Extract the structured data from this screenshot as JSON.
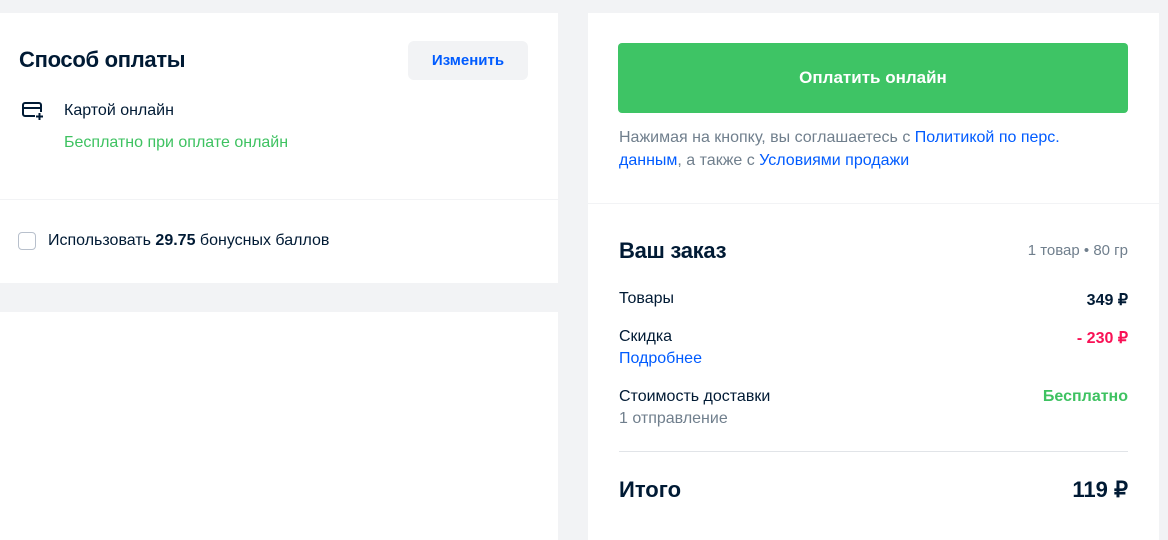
{
  "payment": {
    "title": "Способ оплаты",
    "change_label": "Изменить",
    "method_icon": "card-plus-icon",
    "method_label": "Картой онлайн",
    "method_note": "Бесплатно при оплате онлайн"
  },
  "bonus": {
    "checked": false,
    "text_before": "Использовать ",
    "amount": "29.75",
    "text_after": " бонусных баллов"
  },
  "checkout": {
    "pay_label": "Оплатить онлайн",
    "agreement_prefix": "Нажимая на кнопку, вы соглашаетесь с ",
    "policy_link": "Политикой по перс. данным",
    "agreement_middle": ", а также с ",
    "terms_link": "Условиями продажи"
  },
  "order": {
    "title": "Ваш заказ",
    "summary": "1 товар • 80 гр",
    "goods_label": "Товары",
    "goods_value": "349 ₽",
    "discount_label": "Скидка",
    "discount_value": "- 230 ₽",
    "details_link": "Подробнее",
    "delivery_label": "Стоимость доставки",
    "delivery_value": "Бесплатно",
    "shipment_note": "1 отправление",
    "total_label": "Итого",
    "total_value": "119 ₽"
  },
  "colors": {
    "accent_blue": "#005bff",
    "pay_green": "#3ec465",
    "free_green": "#3ec261",
    "discount_red": "#f91155",
    "muted_text": "#707f8d",
    "page_bg": "#f2f3f5"
  }
}
